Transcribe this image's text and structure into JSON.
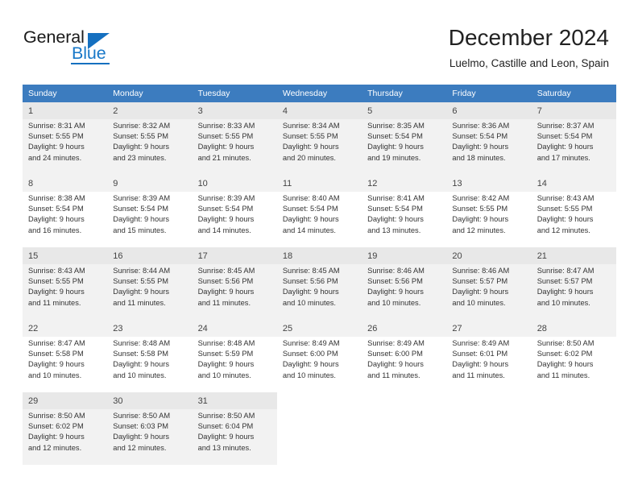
{
  "brand": {
    "name_part1": "General",
    "name_part2": "Blue",
    "logo_icon": "triangle-flag-icon",
    "accent_color": "#1570c0"
  },
  "header": {
    "title": "December 2024",
    "subtitle": "Luelmo, Castille and Leon, Spain"
  },
  "calendar": {
    "header_bg_color": "#3c7cbf",
    "weekdays": [
      "Sunday",
      "Monday",
      "Tuesday",
      "Wednesday",
      "Thursday",
      "Friday",
      "Saturday"
    ],
    "labels": {
      "sunrise": "Sunrise:",
      "sunset": "Sunset:",
      "daylight": "Daylight:"
    },
    "weeks": [
      {
        "days": [
          {
            "num": "1",
            "sunrise": "Sunrise: 8:31 AM",
            "sunset": "Sunset: 5:55 PM",
            "daylight1": "Daylight: 9 hours",
            "daylight2": "and 24 minutes."
          },
          {
            "num": "2",
            "sunrise": "Sunrise: 8:32 AM",
            "sunset": "Sunset: 5:55 PM",
            "daylight1": "Daylight: 9 hours",
            "daylight2": "and 23 minutes."
          },
          {
            "num": "3",
            "sunrise": "Sunrise: 8:33 AM",
            "sunset": "Sunset: 5:55 PM",
            "daylight1": "Daylight: 9 hours",
            "daylight2": "and 21 minutes."
          },
          {
            "num": "4",
            "sunrise": "Sunrise: 8:34 AM",
            "sunset": "Sunset: 5:55 PM",
            "daylight1": "Daylight: 9 hours",
            "daylight2": "and 20 minutes."
          },
          {
            "num": "5",
            "sunrise": "Sunrise: 8:35 AM",
            "sunset": "Sunset: 5:54 PM",
            "daylight1": "Daylight: 9 hours",
            "daylight2": "and 19 minutes."
          },
          {
            "num": "6",
            "sunrise": "Sunrise: 8:36 AM",
            "sunset": "Sunset: 5:54 PM",
            "daylight1": "Daylight: 9 hours",
            "daylight2": "and 18 minutes."
          },
          {
            "num": "7",
            "sunrise": "Sunrise: 8:37 AM",
            "sunset": "Sunset: 5:54 PM",
            "daylight1": "Daylight: 9 hours",
            "daylight2": "and 17 minutes."
          }
        ]
      },
      {
        "days": [
          {
            "num": "8",
            "sunrise": "Sunrise: 8:38 AM",
            "sunset": "Sunset: 5:54 PM",
            "daylight1": "Daylight: 9 hours",
            "daylight2": "and 16 minutes."
          },
          {
            "num": "9",
            "sunrise": "Sunrise: 8:39 AM",
            "sunset": "Sunset: 5:54 PM",
            "daylight1": "Daylight: 9 hours",
            "daylight2": "and 15 minutes."
          },
          {
            "num": "10",
            "sunrise": "Sunrise: 8:39 AM",
            "sunset": "Sunset: 5:54 PM",
            "daylight1": "Daylight: 9 hours",
            "daylight2": "and 14 minutes."
          },
          {
            "num": "11",
            "sunrise": "Sunrise: 8:40 AM",
            "sunset": "Sunset: 5:54 PM",
            "daylight1": "Daylight: 9 hours",
            "daylight2": "and 14 minutes."
          },
          {
            "num": "12",
            "sunrise": "Sunrise: 8:41 AM",
            "sunset": "Sunset: 5:54 PM",
            "daylight1": "Daylight: 9 hours",
            "daylight2": "and 13 minutes."
          },
          {
            "num": "13",
            "sunrise": "Sunrise: 8:42 AM",
            "sunset": "Sunset: 5:55 PM",
            "daylight1": "Daylight: 9 hours",
            "daylight2": "and 12 minutes."
          },
          {
            "num": "14",
            "sunrise": "Sunrise: 8:43 AM",
            "sunset": "Sunset: 5:55 PM",
            "daylight1": "Daylight: 9 hours",
            "daylight2": "and 12 minutes."
          }
        ]
      },
      {
        "days": [
          {
            "num": "15",
            "sunrise": "Sunrise: 8:43 AM",
            "sunset": "Sunset: 5:55 PM",
            "daylight1": "Daylight: 9 hours",
            "daylight2": "and 11 minutes."
          },
          {
            "num": "16",
            "sunrise": "Sunrise: 8:44 AM",
            "sunset": "Sunset: 5:55 PM",
            "daylight1": "Daylight: 9 hours",
            "daylight2": "and 11 minutes."
          },
          {
            "num": "17",
            "sunrise": "Sunrise: 8:45 AM",
            "sunset": "Sunset: 5:56 PM",
            "daylight1": "Daylight: 9 hours",
            "daylight2": "and 11 minutes."
          },
          {
            "num": "18",
            "sunrise": "Sunrise: 8:45 AM",
            "sunset": "Sunset: 5:56 PM",
            "daylight1": "Daylight: 9 hours",
            "daylight2": "and 10 minutes."
          },
          {
            "num": "19",
            "sunrise": "Sunrise: 8:46 AM",
            "sunset": "Sunset: 5:56 PM",
            "daylight1": "Daylight: 9 hours",
            "daylight2": "and 10 minutes."
          },
          {
            "num": "20",
            "sunrise": "Sunrise: 8:46 AM",
            "sunset": "Sunset: 5:57 PM",
            "daylight1": "Daylight: 9 hours",
            "daylight2": "and 10 minutes."
          },
          {
            "num": "21",
            "sunrise": "Sunrise: 8:47 AM",
            "sunset": "Sunset: 5:57 PM",
            "daylight1": "Daylight: 9 hours",
            "daylight2": "and 10 minutes."
          }
        ]
      },
      {
        "days": [
          {
            "num": "22",
            "sunrise": "Sunrise: 8:47 AM",
            "sunset": "Sunset: 5:58 PM",
            "daylight1": "Daylight: 9 hours",
            "daylight2": "and 10 minutes."
          },
          {
            "num": "23",
            "sunrise": "Sunrise: 8:48 AM",
            "sunset": "Sunset: 5:58 PM",
            "daylight1": "Daylight: 9 hours",
            "daylight2": "and 10 minutes."
          },
          {
            "num": "24",
            "sunrise": "Sunrise: 8:48 AM",
            "sunset": "Sunset: 5:59 PM",
            "daylight1": "Daylight: 9 hours",
            "daylight2": "and 10 minutes."
          },
          {
            "num": "25",
            "sunrise": "Sunrise: 8:49 AM",
            "sunset": "Sunset: 6:00 PM",
            "daylight1": "Daylight: 9 hours",
            "daylight2": "and 10 minutes."
          },
          {
            "num": "26",
            "sunrise": "Sunrise: 8:49 AM",
            "sunset": "Sunset: 6:00 PM",
            "daylight1": "Daylight: 9 hours",
            "daylight2": "and 11 minutes."
          },
          {
            "num": "27",
            "sunrise": "Sunrise: 8:49 AM",
            "sunset": "Sunset: 6:01 PM",
            "daylight1": "Daylight: 9 hours",
            "daylight2": "and 11 minutes."
          },
          {
            "num": "28",
            "sunrise": "Sunrise: 8:50 AM",
            "sunset": "Sunset: 6:02 PM",
            "daylight1": "Daylight: 9 hours",
            "daylight2": "and 11 minutes."
          }
        ]
      },
      {
        "days": [
          {
            "num": "29",
            "sunrise": "Sunrise: 8:50 AM",
            "sunset": "Sunset: 6:02 PM",
            "daylight1": "Daylight: 9 hours",
            "daylight2": "and 12 minutes."
          },
          {
            "num": "30",
            "sunrise": "Sunrise: 8:50 AM",
            "sunset": "Sunset: 6:03 PM",
            "daylight1": "Daylight: 9 hours",
            "daylight2": "and 12 minutes."
          },
          {
            "num": "31",
            "sunrise": "Sunrise: 8:50 AM",
            "sunset": "Sunset: 6:04 PM",
            "daylight1": "Daylight: 9 hours",
            "daylight2": "and 13 minutes."
          },
          {
            "num": "",
            "sunrise": "",
            "sunset": "",
            "daylight1": "",
            "daylight2": ""
          },
          {
            "num": "",
            "sunrise": "",
            "sunset": "",
            "daylight1": "",
            "daylight2": ""
          },
          {
            "num": "",
            "sunrise": "",
            "sunset": "",
            "daylight1": "",
            "daylight2": ""
          },
          {
            "num": "",
            "sunrise": "",
            "sunset": "",
            "daylight1": "",
            "daylight2": ""
          }
        ]
      }
    ]
  }
}
